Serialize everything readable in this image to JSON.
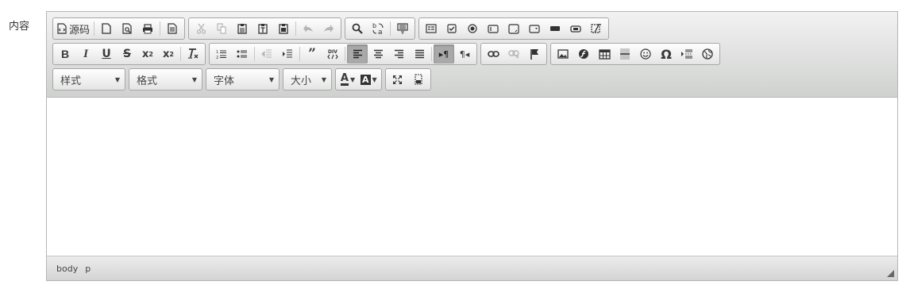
{
  "form": {
    "field_label": "内容"
  },
  "toolbar": {
    "source_label": "源码",
    "styles": {
      "label": "样式"
    },
    "format": {
      "label": "格式"
    },
    "font": {
      "label": "字体"
    },
    "size": {
      "label": "大小"
    },
    "text_color_glyph": "A",
    "bg_color_glyph": "A"
  },
  "statusbar": {
    "path": [
      "body",
      "p"
    ]
  },
  "colors": {
    "toolbar_top": "#f2f2f2",
    "toolbar_bottom": "#cfd1cf",
    "border": "#b6b6b6",
    "active_button": "#a9a9a9"
  }
}
